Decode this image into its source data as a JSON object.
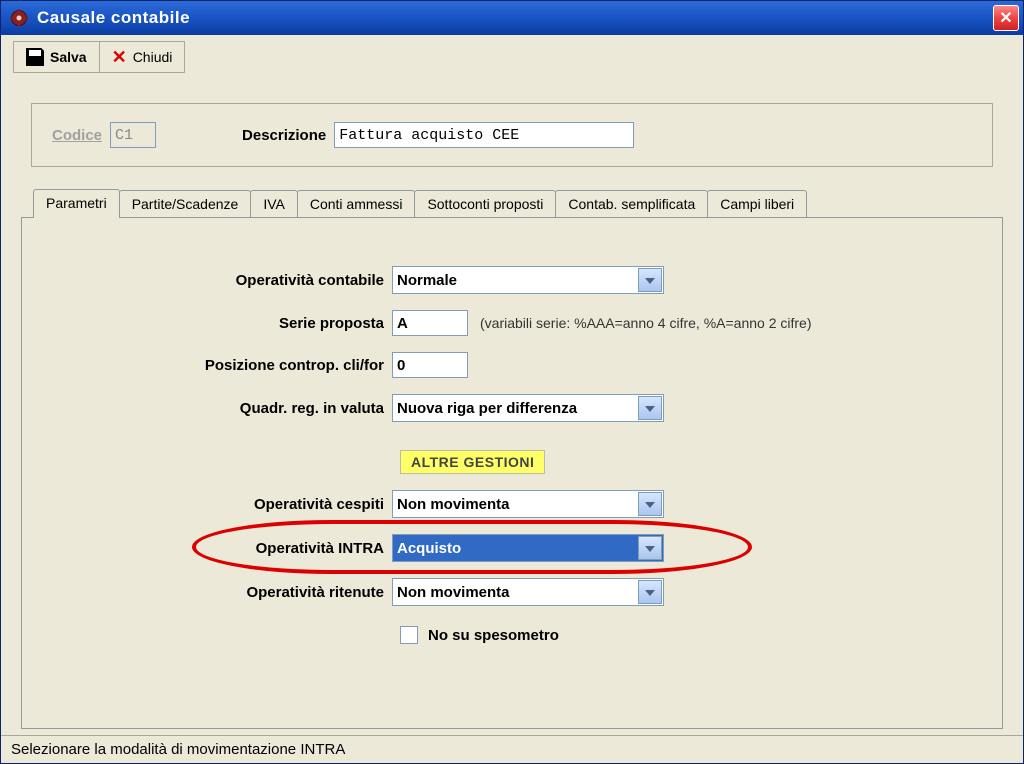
{
  "window": {
    "title": "Causale contabile"
  },
  "toolbar": {
    "save_label": "Salva",
    "close_label": "Chiudi"
  },
  "header": {
    "codice_label": "Codice",
    "codice_value": "C1",
    "descrizione_label": "Descrizione",
    "descrizione_value": "Fattura acquisto CEE"
  },
  "tabs": [
    "Parametri",
    "Partite/Scadenze",
    "IVA",
    "Conti ammessi",
    "Sottoconti proposti",
    "Contab. semplificata",
    "Campi liberi"
  ],
  "form": {
    "operativita_contabile_label": "Operatività contabile",
    "operativita_contabile_value": "Normale",
    "serie_proposta_label": "Serie proposta",
    "serie_proposta_value": "A",
    "serie_hint": "(variabili serie: %AAA=anno 4 cifre, %A=anno 2 cifre)",
    "posizione_controp_label": "Posizione controp. cli/for",
    "posizione_controp_value": "0",
    "quadr_reg_valuta_label": "Quadr. reg. in valuta",
    "quadr_reg_valuta_value": "Nuova riga per differenza",
    "altre_gestioni_badge": "ALTRE GESTIONI",
    "operativita_cespiti_label": "Operatività cespiti",
    "operativita_cespiti_value": "Non movimenta",
    "operativita_intra_label": "Operatività INTRA",
    "operativita_intra_value": "Acquisto",
    "operativita_ritenute_label": "Operatività ritenute",
    "operativita_ritenute_value": "Non movimenta",
    "no_spesometro_label": "No su spesometro",
    "no_spesometro_checked": false
  },
  "statusbar": {
    "text": "Selezionare la modalità di movimentazione INTRA"
  }
}
